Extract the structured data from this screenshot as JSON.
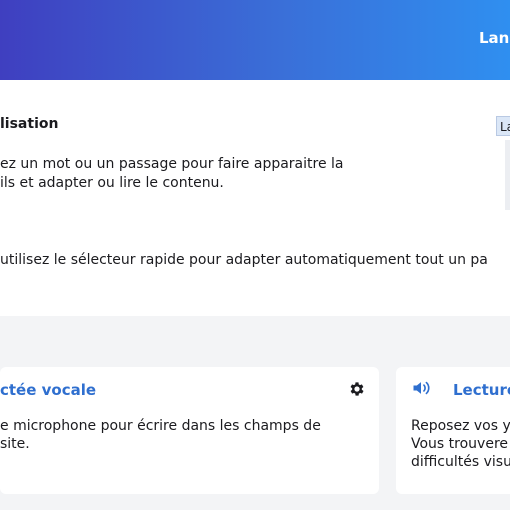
{
  "header": {
    "lang_label": "Lang"
  },
  "personalisation": {
    "title": "lisation",
    "language_chip": "La",
    "description_lines": [
      "ez un mot ou un passage pour faire apparaitre la",
      "ils et adapter ou lire le contenu."
    ],
    "hint": "utilisez le sélecteur rapide pour adapter automatiquement tout un pa"
  },
  "cards": [
    {
      "title": "ctée vocale",
      "icon": "gear-icon",
      "body_lines": [
        "e microphone pour écrire dans les champs de",
        " site."
      ]
    },
    {
      "title": "Lecture",
      "icon": "speaker-icon",
      "body_lines": [
        "Reposez vos y",
        "Vous trouvere",
        "difficultés visu"
      ]
    }
  ],
  "colors": {
    "header_gradient_start": "#3f3fc0",
    "header_gradient_end": "#2f8ff0",
    "card_title": "#2f6fcf",
    "background": "#f3f4f6"
  }
}
